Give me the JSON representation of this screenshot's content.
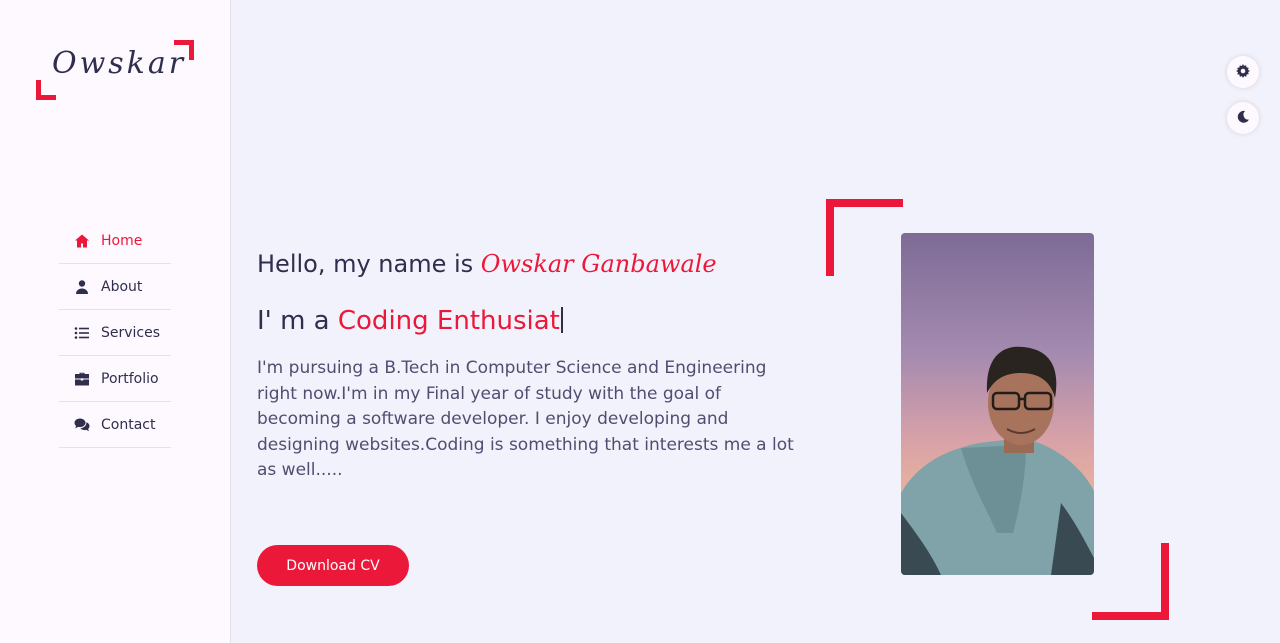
{
  "brand": {
    "logo_text": "Owskar"
  },
  "nav": [
    {
      "label": "Home",
      "icon": "home-icon",
      "active": true
    },
    {
      "label": "About",
      "icon": "user-icon",
      "active": false
    },
    {
      "label": "Services",
      "icon": "list-icon",
      "active": false
    },
    {
      "label": "Portfolio",
      "icon": "briefcase-icon",
      "active": false
    },
    {
      "label": "Contact",
      "icon": "comments-icon",
      "active": false
    }
  ],
  "hero": {
    "greeting": "Hello, my name is ",
    "name": "Owskar Ganbawale",
    "iam_prefix": "I' m a ",
    "role": "Coding Enthusiat",
    "bio": "I'm pursuing a B.Tech in Computer Science and Engineering right now.I'm in my Final year of study with the goal of becoming a software developer. I enjoy developing and designing websites.Coding is something that interests me a lot as well.....",
    "button_label": "Download CV"
  },
  "controls": {
    "settings_icon": "gear-icon",
    "theme_icon": "moon-icon"
  },
  "colors": {
    "accent": "#ec1839",
    "text": "#302e4d",
    "bg": "#f2f2fc",
    "sidebar_bg": "#fdf9ff"
  }
}
